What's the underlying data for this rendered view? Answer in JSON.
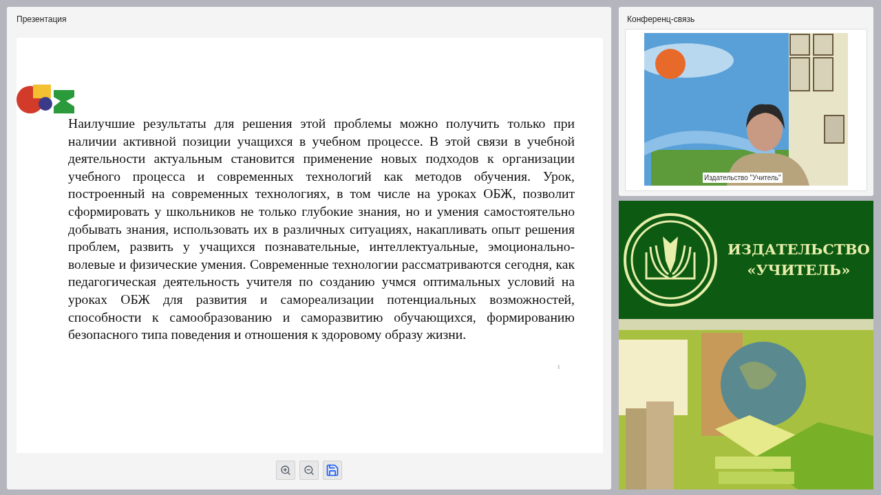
{
  "presentation": {
    "title": "Презентация",
    "slide": {
      "paragraph": "Наилучшие результаты для решения этой проблемы можно получить только при наличии активной позиции учащихся в учебном процессе. В этой связи в учебной деятельности актуальным становится применение новых подходов к организации учебного процесса и современных технологий как методов обучения. Урок, построенный на современных технологиях, в том числе на уроках ОБЖ, позволит сформировать у школьников не только глубокие знания, но и умения самостоятельно добывать знания, использовать их в различных ситуациях, накапливать опыт решения проблем, развить у учащихся познавательные, интеллектуальные, эмоционально-волевые и физические умения. Современные технологии рассматриваются сегодня, как педагогическая деятельность учителя по созданию учмся оптимальных условий на уроках ОБЖ для развития и самореализации потенциальных возможностей, способности к самообразованию и саморазвитию обучающихся, формированию безопасного типа поведения и отношения к здоровому образу жизни.",
      "page_number": "1"
    },
    "toolbar": [
      {
        "kind": "zoom_in"
      },
      {
        "kind": "zoom_out"
      },
      {
        "kind": "save"
      }
    ]
  },
  "conference": {
    "title": "Конференц-связь",
    "participant_label": "Издательство \"Учитель\""
  },
  "banner": {
    "title_lines": [
      "ИЗДАТЕЛЬСТВО",
      "«УЧИТЕЛЬ»"
    ]
  }
}
